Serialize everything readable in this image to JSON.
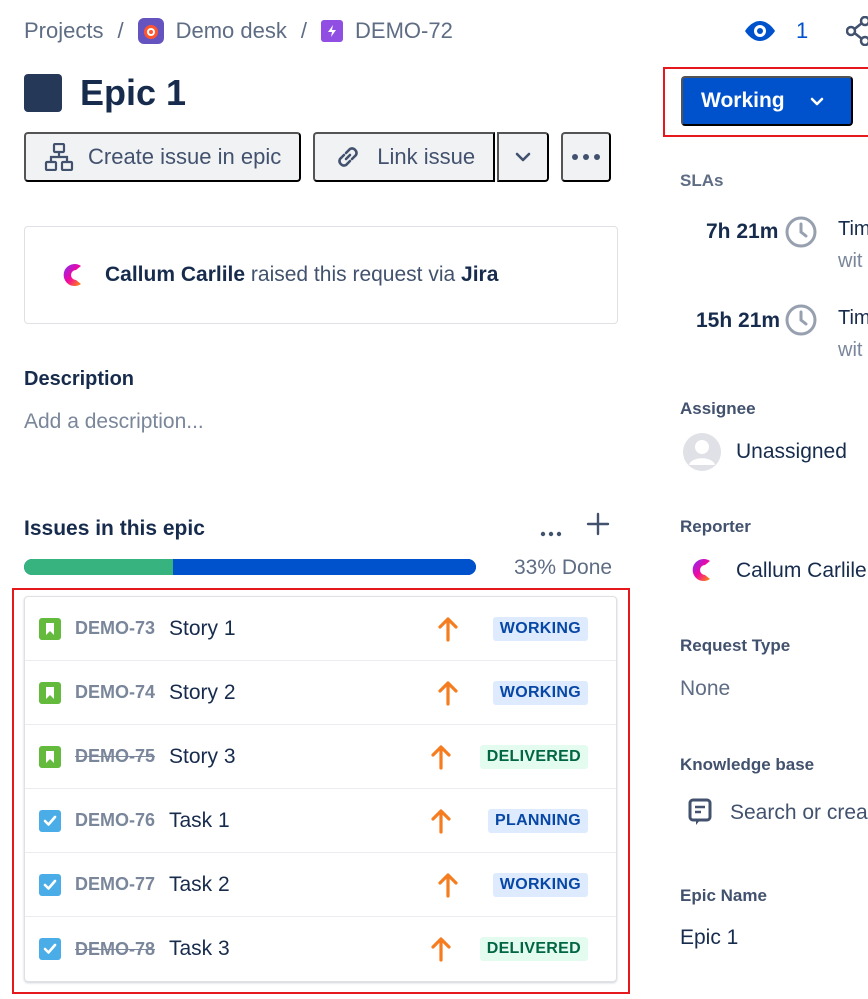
{
  "breadcrumb": {
    "projects": "Projects",
    "separator": "/",
    "project": "Demo desk",
    "issue_key": "DEMO-72"
  },
  "watchers": {
    "count": "1"
  },
  "issue": {
    "title": "Epic 1"
  },
  "toolbar": {
    "create_issue": "Create issue in epic",
    "link_issue": "Link issue"
  },
  "request": {
    "reporter": "Callum Carlile",
    "text": "raised this request via",
    "channel": "Jira"
  },
  "description": {
    "label": "Description",
    "placeholder": "Add a description..."
  },
  "epic_issues": {
    "heading": "Issues in this epic",
    "progress_done_fraction": 0.33,
    "progress_label": "33% Done",
    "items": [
      {
        "type": "story",
        "key": "DEMO-73",
        "summary": "Story 1",
        "status": "WORKING",
        "status_color": "blue",
        "done": false,
        "priority": "high"
      },
      {
        "type": "story",
        "key": "DEMO-74",
        "summary": "Story 2",
        "status": "WORKING",
        "status_color": "blue",
        "done": false,
        "priority": "high"
      },
      {
        "type": "story",
        "key": "DEMO-75",
        "summary": "Story 3",
        "status": "DELIVERED",
        "status_color": "green",
        "done": true,
        "priority": "high"
      },
      {
        "type": "task",
        "key": "DEMO-76",
        "summary": "Task 1",
        "status": "PLANNING",
        "status_color": "blue",
        "done": false,
        "priority": "high"
      },
      {
        "type": "task",
        "key": "DEMO-77",
        "summary": "Task 2",
        "status": "WORKING",
        "status_color": "blue",
        "done": false,
        "priority": "high"
      },
      {
        "type": "task",
        "key": "DEMO-78",
        "summary": "Task 3",
        "status": "DELIVERED",
        "status_color": "green",
        "done": true,
        "priority": "high"
      }
    ]
  },
  "sidebar": {
    "status_button": "Working",
    "slas_label": "SLAs",
    "slas": [
      {
        "time": "7h 21m",
        "title": "Tim",
        "sub": "wit"
      },
      {
        "time": "15h 21m",
        "title": "Tim",
        "sub": "wit"
      }
    ],
    "assignee_label": "Assignee",
    "assignee": "Unassigned",
    "reporter_label": "Reporter",
    "reporter": "Callum Carlile",
    "request_type_label": "Request Type",
    "request_type": "None",
    "kb_label": "Knowledge base",
    "kb_placeholder": "Search or crea",
    "epic_name_label": "Epic Name",
    "epic_name": "Epic 1"
  },
  "colors": {
    "primary": "#0052cc",
    "highlight": "#e5181d",
    "story": "#63ba3c",
    "task": "#4bade8",
    "priority_high": "#f57c1f",
    "progress_done": "#36b37e"
  }
}
